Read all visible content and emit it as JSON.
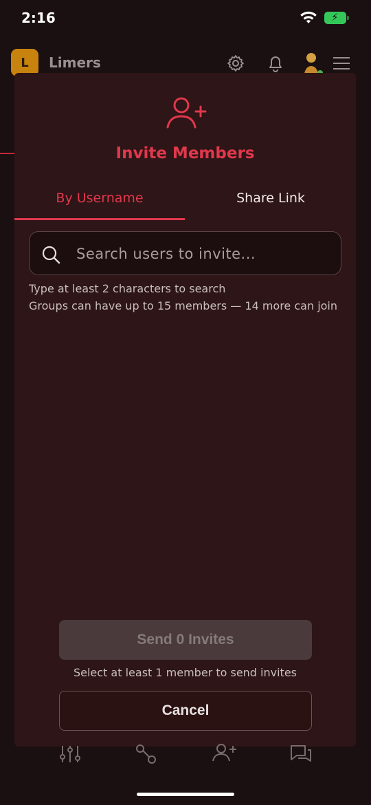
{
  "status_bar": {
    "time": "2:16"
  },
  "app_header": {
    "group_initial": "L",
    "group_name": "Limers"
  },
  "modal": {
    "title": "Invite Members",
    "tabs": [
      {
        "label": "By Username",
        "active": true
      },
      {
        "label": "Share Link",
        "active": false
      }
    ],
    "search": {
      "placeholder": "Search users to invite...",
      "value": ""
    },
    "hints": [
      "Type at least 2 characters to search",
      "Groups can have up to 15 members — 14 more can join"
    ],
    "send_button": "Send 0 Invites",
    "send_hint": "Select at least 1 member to send invites",
    "cancel_button": "Cancel"
  },
  "colors": {
    "accent": "#e0384c",
    "modal_bg": "#2e1517",
    "page_bg": "#1b1011",
    "battery": "#34c759"
  },
  "icons": [
    "wifi-icon",
    "battery-icon",
    "gear-icon",
    "bell-icon",
    "menu-icon",
    "add-user-icon",
    "search-icon",
    "sliders-icon",
    "share-icon",
    "add-user-icon",
    "chat-icon"
  ]
}
